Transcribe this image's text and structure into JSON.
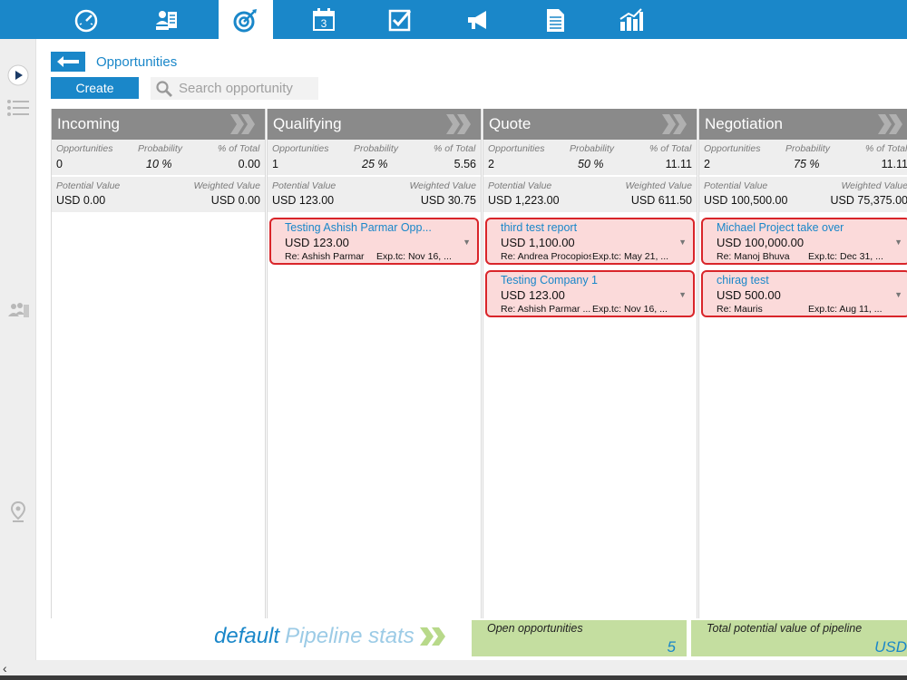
{
  "nav": {
    "items": [
      {
        "icon": "dashboard-icon"
      },
      {
        "icon": "contacts-icon"
      },
      {
        "icon": "opportunities-target-icon",
        "active": true
      },
      {
        "icon": "calendar-icon",
        "text": "3"
      },
      {
        "icon": "tasks-check-icon"
      },
      {
        "icon": "campaigns-megaphone-icon"
      },
      {
        "icon": "documents-icon"
      },
      {
        "icon": "reports-chart-icon"
      }
    ],
    "accent": "#1a87c9"
  },
  "header": {
    "title": "Opportunities",
    "create_label": "Create",
    "search_placeholder": "Search opportunity"
  },
  "labels": {
    "opportunities": "Opportunities",
    "probability": "Probability",
    "pct_total": "% of Total",
    "potential_value": "Potential Value",
    "weighted_value": "Weighted Value"
  },
  "columns": [
    {
      "name": "Incoming",
      "opportunities": "0",
      "probability": "10 %",
      "pct_total": "0.00",
      "potential_value": "USD 0.00",
      "weighted_value": "USD 0.00",
      "cards": []
    },
    {
      "name": "Qualifying",
      "opportunities": "1",
      "probability": "25 %",
      "pct_total": "5.56",
      "potential_value": "USD 123.00",
      "weighted_value": "USD 30.75",
      "cards": [
        {
          "title": "Testing Ashish Parmar Opp...",
          "amount": "USD 123.00",
          "re": "Re: Ashish Parmar",
          "exp": "Exp.tc: Nov 16, ..."
        }
      ]
    },
    {
      "name": "Quote",
      "opportunities": "2",
      "probability": "50 %",
      "pct_total": "11.11",
      "potential_value": "USD 1,223.00",
      "weighted_value": "USD 611.50",
      "cards": [
        {
          "title": "third test report",
          "amount": "USD 1,100.00",
          "re": "Re: Andrea Procopios",
          "exp": "Exp.tc: May 21, ..."
        },
        {
          "title": "Testing Company 1",
          "amount": "USD 123.00",
          "re": "Re: Ashish Parmar ...",
          "exp": "Exp.tc: Nov 16, ..."
        }
      ]
    },
    {
      "name": "Negotiation",
      "opportunities": "2",
      "probability": "75 %",
      "pct_total": "11.11",
      "potential_value": "USD 100,500.00",
      "weighted_value": "USD 75,375.00",
      "cards": [
        {
          "title": "Michael Project take over",
          "amount": "USD 100,000.00",
          "re": "Re: Manoj Bhuva",
          "exp": "Exp.tc: Dec 31, ..."
        },
        {
          "title": "chirag test",
          "amount": "USD 500.00",
          "re": "Re: Mauris",
          "exp": "Exp.tc: Aug 11, ..."
        }
      ]
    }
  ],
  "footer": {
    "pipeline_name": "default",
    "pipeline_stats": "Pipeline stats",
    "open_label": "Open opportunities",
    "open_value": "5",
    "total_label": "Total potential value of pipeline",
    "total_value": "USD"
  },
  "card_colors": {
    "border": "#d9252a",
    "fill": "#fbdada"
  }
}
